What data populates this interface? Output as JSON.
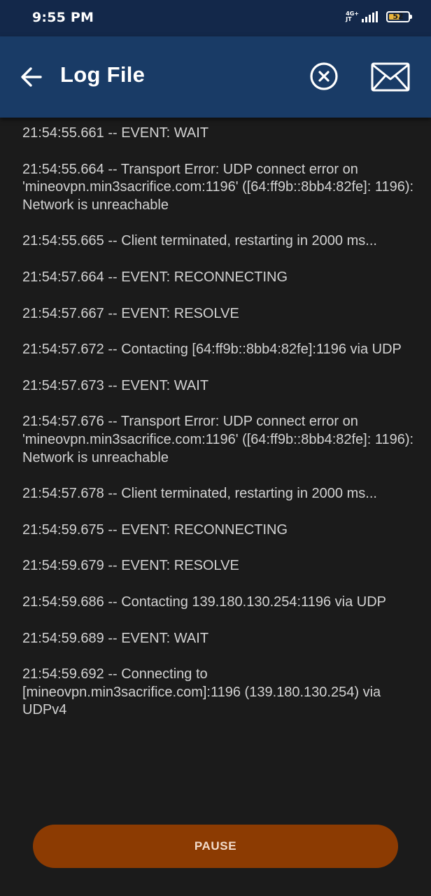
{
  "status_bar": {
    "time": "9:55 PM",
    "network_type": "4G+",
    "network_sub": "JT",
    "battery_level": "52",
    "battery_fraction": 0.52,
    "signal_icon": "signal-bars-icon",
    "battery_icon": "battery-icon"
  },
  "app_bar": {
    "title": "Log File",
    "back_icon": "arrow-left-icon",
    "clear_icon": "close-circle-icon",
    "mail_icon": "envelope-icon",
    "background_color": "#193b66"
  },
  "log": {
    "entries": [
      "21:54:55.661 -- EVENT: WAIT",
      "21:54:55.664 -- Transport Error: UDP connect error on 'mineovpn.min3sacrifice.com:1196' ([64:ff9b::8bb4:82fe]: 1196): Network is unreachable",
      "21:54:55.665 -- Client terminated, restarting in 2000 ms...",
      "21:54:57.664 -- EVENT: RECONNECTING",
      "21:54:57.667 -- EVENT: RESOLVE",
      "21:54:57.672 -- Contacting [64:ff9b::8bb4:82fe]:1196 via UDP",
      "21:54:57.673 -- EVENT: WAIT",
      "21:54:57.676 -- Transport Error: UDP connect error on 'mineovpn.min3sacrifice.com:1196' ([64:ff9b::8bb4:82fe]: 1196): Network is unreachable",
      "21:54:57.678 -- Client terminated, restarting in 2000 ms...",
      "21:54:59.675 -- EVENT: RECONNECTING",
      "21:54:59.679 -- EVENT: RESOLVE",
      "21:54:59.686 -- Contacting 139.180.130.254:1196 via UDP",
      "21:54:59.689 -- EVENT: WAIT",
      "21:54:59.692 -- Connecting to [mineovpn.min3sacrifice.com]:1196 (139.180.130.254) via UDPv4"
    ]
  },
  "footer": {
    "pause_label": "PAUSE",
    "pause_color": "#8c3b02"
  }
}
